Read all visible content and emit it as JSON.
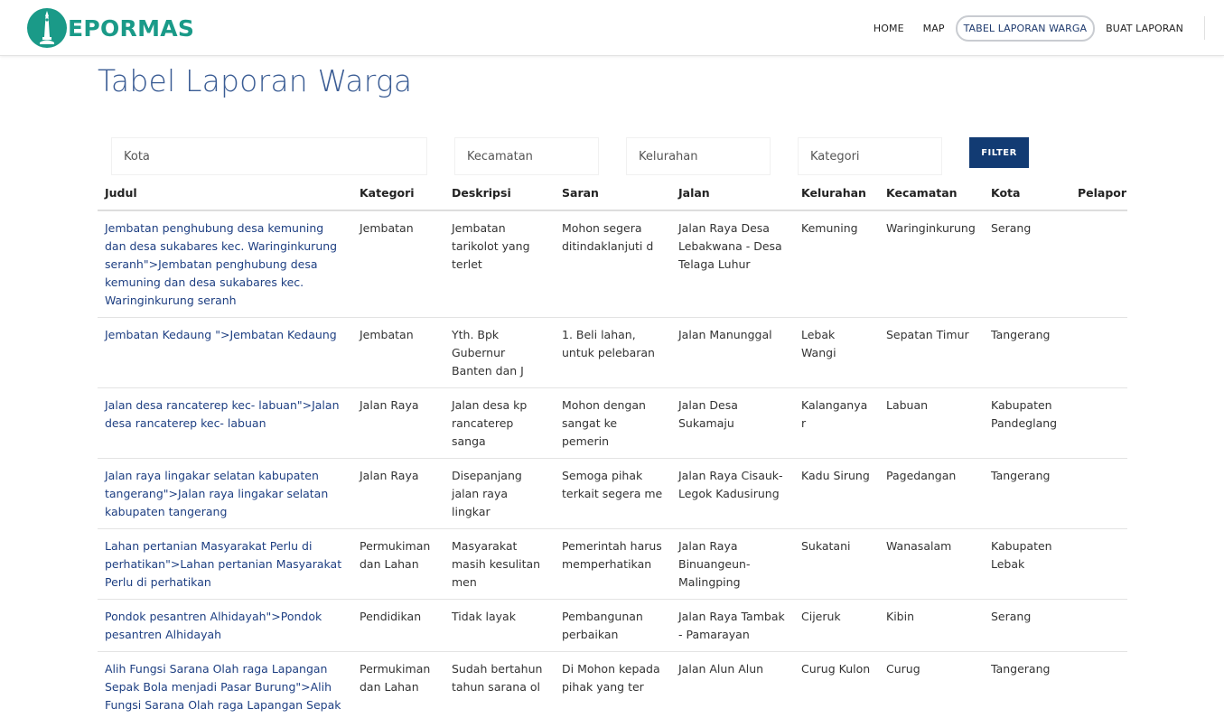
{
  "brand": {
    "name": "EPORMAS"
  },
  "nav": {
    "items": [
      {
        "label": "HOME"
      },
      {
        "label": "MAP"
      },
      {
        "label": "TABEL LAPORAN WARGA"
      },
      {
        "label": "BUAT LAPORAN"
      }
    ]
  },
  "page": {
    "title": "Tabel Laporan Warga"
  },
  "filters": {
    "kota_placeholder": "Kota",
    "kecamatan_placeholder": "Kecamatan",
    "kelurahan_placeholder": "Kelurahan",
    "kategori_placeholder": "Kategori",
    "button_label": "FILTER"
  },
  "table": {
    "headers": [
      "Judul",
      "Kategori",
      "Deskripsi",
      "Saran",
      "Jalan",
      "Kelurahan",
      "Kecamatan",
      "Kota",
      "Pelapor"
    ],
    "rows": [
      [
        "Jembatan penghubung desa kemuning dan desa sukabares kec. Waringinkurung seranh\">Jembatan penghubung desa kemuning dan desa sukabares kec. Waringinkurung seranh",
        "Jembatan",
        "Jembatan tarikolot yang terlet",
        "Mohon segera ditindaklanjuti d",
        "Jalan Raya Desa Lebakwana - Desa Telaga Luhur",
        "Kemuning",
        "Waringinkurung",
        "Serang",
        ""
      ],
      [
        "Jembatan Kedaung \">Jembatan Kedaung",
        "Jembatan",
        "Yth. Bpk Gubernur Banten dan J",
        "1. Beli lahan, untuk pelebaran",
        "Jalan Manunggal",
        "Lebak Wangi",
        "Sepatan Timur",
        "Tangerang",
        ""
      ],
      [
        "Jalan desa rancaterep kec- labuan\">Jalan desa rancaterep kec- labuan",
        "Jalan Raya",
        "Jalan desa kp rancaterep sanga",
        "Mohon dengan sangat ke pemerin",
        "Jalan Desa Sukamaju",
        "Kalanganyar",
        "Labuan",
        "Kabupaten Pandeglang",
        ""
      ],
      [
        "Jalan raya lingakar selatan kabupaten tangerang\">Jalan raya lingakar selatan kabupaten tangerang",
        "Jalan Raya",
        "Disepanjang jalan raya lingkar",
        "Semoga pihak terkait segera me",
        "Jalan Raya Cisauk-Legok Kadusirung",
        "Kadu Sirung",
        "Pagedangan",
        "Tangerang",
        ""
      ],
      [
        "Lahan pertanian Masyarakat Perlu di perhatikan\">Lahan pertanian Masyarakat Perlu di perhatikan",
        "Permukiman dan Lahan",
        "Masyarakat masih kesulitan men",
        "Pemerintah harus memperhatikan",
        "Jalan Raya Binuangeun-Malingping",
        "Sukatani",
        "Wanasalam",
        "Kabupaten Lebak",
        ""
      ],
      [
        "Pondok pesantren Alhidayah\">Pondok pesantren Alhidayah",
        "Pendidikan",
        "Tidak layak",
        "Pembangunan perbaikan",
        "Jalan Raya Tambak - Pamarayan",
        "Cijeruk",
        "Kibin",
        "Serang",
        ""
      ],
      [
        "Alih Fungsi Sarana Olah raga Lapangan Sepak Bola menjadi Pasar Burung\">Alih Fungsi Sarana Olah raga Lapangan Sepak Bola menjadi Pasar Burung",
        "Permukiman dan Lahan",
        "Sudah bertahun tahun sarana ol",
        "Di Mohon kepada pihak yang ter",
        "Jalan Alun Alun",
        "Curug Kulon",
        "Curug",
        "Tangerang",
        ""
      ]
    ]
  },
  "colors": {
    "brand": "#1a9a88",
    "title": "#3a5c94",
    "button": "#123b73",
    "link": "#1e3f82"
  },
  "icons": {
    "logo": "tower-logo-icon"
  }
}
